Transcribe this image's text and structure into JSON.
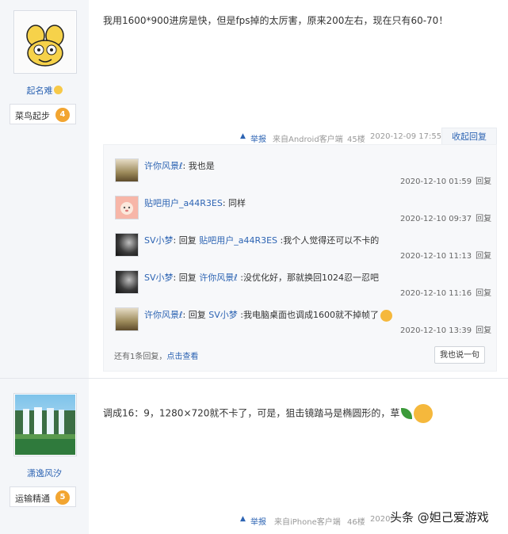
{
  "post1": {
    "author": {
      "name": "起名难",
      "rank": "菜鸟起步",
      "level": "4"
    },
    "content": "我用1600*900进房是快，但是fps掉的太厉害，原来200左右，现在只有60-70！",
    "meta": {
      "report": "举报",
      "source": "来自Android客户端",
      "floor": "45楼",
      "time": "2020-12-09 17:55",
      "collapse": "收起回复"
    },
    "replies": [
      {
        "segments": [
          {
            "t": "许你风景",
            "c": "name"
          },
          {
            "t": "ℓ",
            "c": "name"
          },
          {
            "t": ": 我也是",
            "c": "text"
          }
        ],
        "time": "2020-12-10 01:59",
        "reply": "回复"
      },
      {
        "segments": [
          {
            "t": "贴吧用户_a44R3ES",
            "c": "name"
          },
          {
            "t": ": 同样",
            "c": "text"
          }
        ],
        "time": "2020-12-10 09:37",
        "reply": "回复"
      },
      {
        "segments": [
          {
            "t": "SV小梦",
            "c": "name"
          },
          {
            "t": ": 回复 ",
            "c": "text"
          },
          {
            "t": "贴吧用户_a44R3ES",
            "c": "name"
          },
          {
            "t": " :我个人觉得还可以不卡的",
            "c": "text"
          }
        ],
        "time": "2020-12-10 11:13",
        "reply": "回复"
      },
      {
        "segments": [
          {
            "t": "SV小梦",
            "c": "name"
          },
          {
            "t": ": 回复 ",
            "c": "text"
          },
          {
            "t": "许你风景",
            "c": "name"
          },
          {
            "t": "ℓ",
            "c": "name"
          },
          {
            "t": " :没优化好，那就换回1024忍一忍吧",
            "c": "text"
          }
        ],
        "time": "2020-12-10 11:16",
        "reply": "回复"
      },
      {
        "segments": [
          {
            "t": "许你风景",
            "c": "name"
          },
          {
            "t": "ℓ",
            "c": "name"
          },
          {
            "t": ": 回复 ",
            "c": "text"
          },
          {
            "t": "SV小梦",
            "c": "name"
          },
          {
            "t": " :我电脑桌面也调成1600就不掉帧了",
            "c": "text"
          }
        ],
        "time": "2020-12-10 13:39",
        "reply": "回复"
      }
    ],
    "more": {
      "text": "还有1条回复，",
      "link": "点击查看"
    },
    "say_button": "我也说一句"
  },
  "post2": {
    "author": {
      "name": "潇逸风汐",
      "rank": "运输精通",
      "level": "5"
    },
    "content": "调成16：9，1280×720就不卡了，可是，狙击镜踏马是椭圆形的，草",
    "meta": {
      "report": "举报",
      "source": "来自iPhone客户端",
      "floor": "46楼",
      "time": "2020-"
    }
  },
  "watermark": "头条 @妲己爱游戏",
  "colors": {
    "link": "#2d64b3",
    "sidebar": "#f4f6f9",
    "badge": "#f2a531"
  }
}
